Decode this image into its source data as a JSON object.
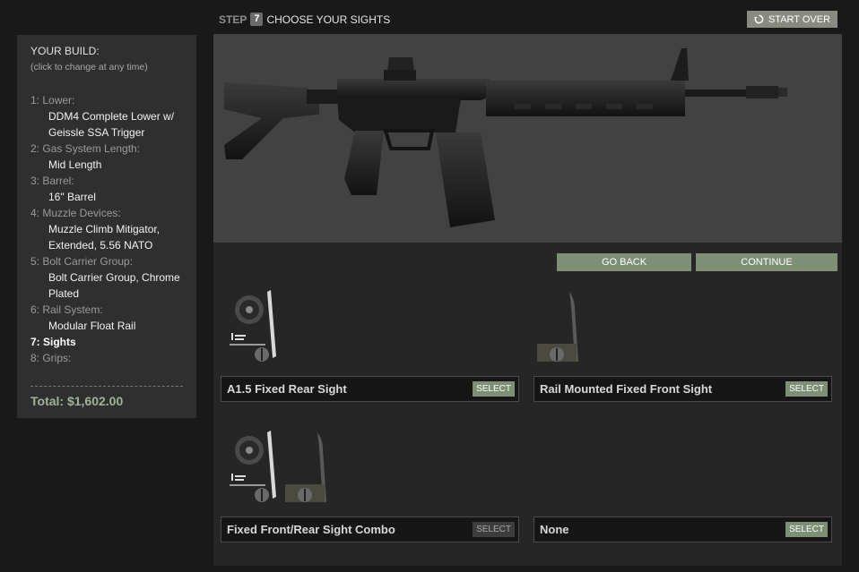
{
  "header": {
    "step_label": "STEP",
    "step_number": "7",
    "step_title": "CHOOSE YOUR SIGHTS",
    "start_over_label": "START OVER"
  },
  "sidebar": {
    "title": "YOUR BUILD:",
    "subtitle": "(click to change at any time)",
    "items": [
      {
        "category": "1: Lower:",
        "value": "DDM4 Complete Lower w/ Geissle SSA Trigger"
      },
      {
        "category": "2: Gas System Length:",
        "value": "Mid Length"
      },
      {
        "category": "3: Barrel:",
        "value": "16\" Barrel"
      },
      {
        "category": "4: Muzzle Devices:",
        "value": "Muzzle Climb Mitigator, Extended, 5.56 NATO"
      },
      {
        "category": "5: Bolt Carrier Group:",
        "value": "Bolt Carrier Group, Chrome Plated"
      },
      {
        "category": "6: Rail System:",
        "value": "Modular Float Rail"
      },
      {
        "category": "7: Sights",
        "value": ""
      },
      {
        "category": "8: Grips:",
        "value": ""
      }
    ],
    "active_index": 6,
    "total": "Total: $1,602.00"
  },
  "nav": {
    "go_back_label": "GO BACK",
    "continue_label": "CONTINUE"
  },
  "options": [
    {
      "label": "A1.5 Fixed Rear Sight",
      "select_label": "SELECT",
      "images": [
        "rear-sight"
      ],
      "select_dimmed": false
    },
    {
      "label": "Rail Mounted Fixed Front Sight",
      "select_label": "SELECT",
      "images": [
        "front-sight"
      ],
      "select_dimmed": false
    },
    {
      "label": "Fixed Front/Rear Sight Combo",
      "select_label": "SELECT",
      "images": [
        "rear-sight",
        "front-sight"
      ],
      "select_dimmed": true
    },
    {
      "label": "None",
      "select_label": "SELECT",
      "images": [],
      "select_dimmed": false
    }
  ],
  "colors": {
    "accent_green": "#7d8f74",
    "total_green": "#9fb398",
    "background": "#191919",
    "panel": "#2f2f2f"
  }
}
